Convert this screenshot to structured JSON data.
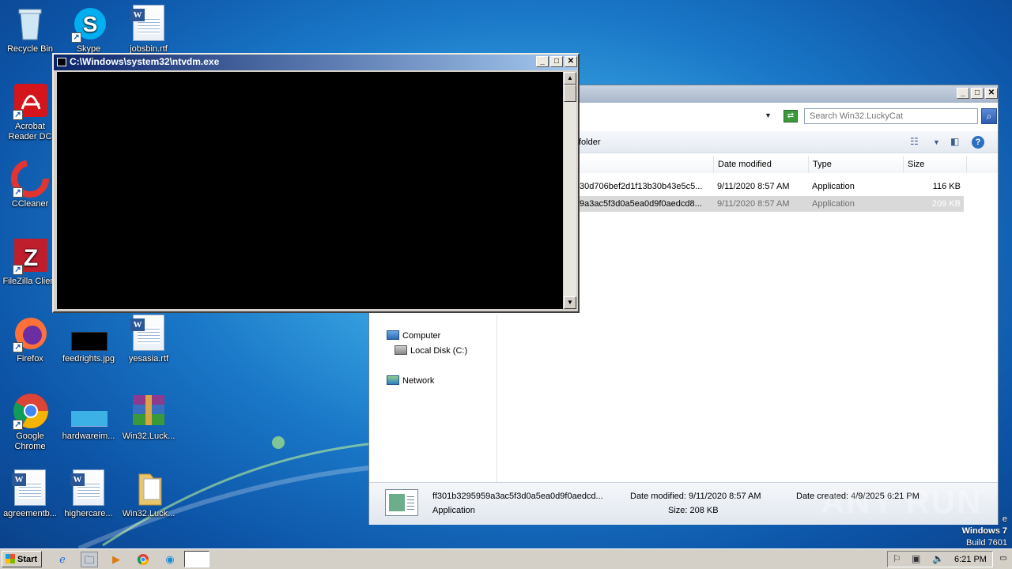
{
  "desktop": {
    "icons": [
      {
        "label": "Recycle Bin",
        "icon": "recycle-bin-icon"
      },
      {
        "label": "Skype",
        "icon": "skype-icon"
      },
      {
        "label": "jobsbin.rtf",
        "icon": "word-document-icon"
      },
      {
        "label": "Acrobat Reader DC",
        "icon": "acrobat-icon"
      },
      {
        "label": "CCleaner",
        "icon": "ccleaner-icon"
      },
      {
        "label": "FileZilla Client",
        "icon": "filezilla-icon"
      },
      {
        "label": "Firefox",
        "icon": "firefox-icon"
      },
      {
        "label": "feedrights.jpg",
        "icon": "image-file-icon"
      },
      {
        "label": "yesasia.rtf",
        "icon": "word-document-icon"
      },
      {
        "label": "Google Chrome",
        "icon": "chrome-icon"
      },
      {
        "label": "hardwareim...",
        "icon": "image-file-icon"
      },
      {
        "label": "Win32.Luck...",
        "icon": "winrar-archive-icon"
      },
      {
        "label": "agreementb...",
        "icon": "word-document-icon"
      },
      {
        "label": "highercare...",
        "icon": "word-document-icon"
      },
      {
        "label": "Win32.Luck...",
        "icon": "folder-icon"
      }
    ]
  },
  "ntvdm": {
    "title": "C:\\Windows\\system32\\ntvdm.exe",
    "minimize": "_",
    "maximize": "□",
    "close": "✕"
  },
  "explorer": {
    "minimize": "_",
    "maximize": "□",
    "close": "✕",
    "search_placeholder": "Search Win32.LuckyCat",
    "toolbar": {
      "new_folder": "folder"
    },
    "columns": {
      "date": "Date modified",
      "type": "Type",
      "size": "Size"
    },
    "files": [
      {
        "name": "30d706bef2d1f13b30b43e5c5...",
        "date": "9/11/2020 8:57 AM",
        "type": "Application",
        "size": "116 KB",
        "selected": false
      },
      {
        "name": "9a3ac5f3d0a5ea0d9f0aedcd8...",
        "date": "9/11/2020 8:57 AM",
        "type": "Application",
        "size": "209 KB",
        "selected": true
      }
    ],
    "nav": {
      "computer": "Computer",
      "local_disk": "Local Disk (C:)",
      "network": "Network"
    },
    "details": {
      "name": "ff301b3295959a3ac5f3d0a5ea0d9f0aedcd...",
      "type": "Application",
      "date_modified": "Date modified: 9/11/2020 8:57 AM",
      "size": "Size: 208 KB",
      "date_created": "Date created: 4/9/2025 6:21 PM"
    }
  },
  "watermark": "ANY RUN",
  "windows_info": {
    "edition": "Windows 7",
    "build": "Build 7601",
    "edge_char": "e"
  },
  "taskbar": {
    "start": "Start",
    "clock": "6:21 PM",
    "icons": [
      "ie-icon",
      "explorer-icon",
      "media-player-icon",
      "chrome-icon",
      "edge-icon"
    ]
  }
}
